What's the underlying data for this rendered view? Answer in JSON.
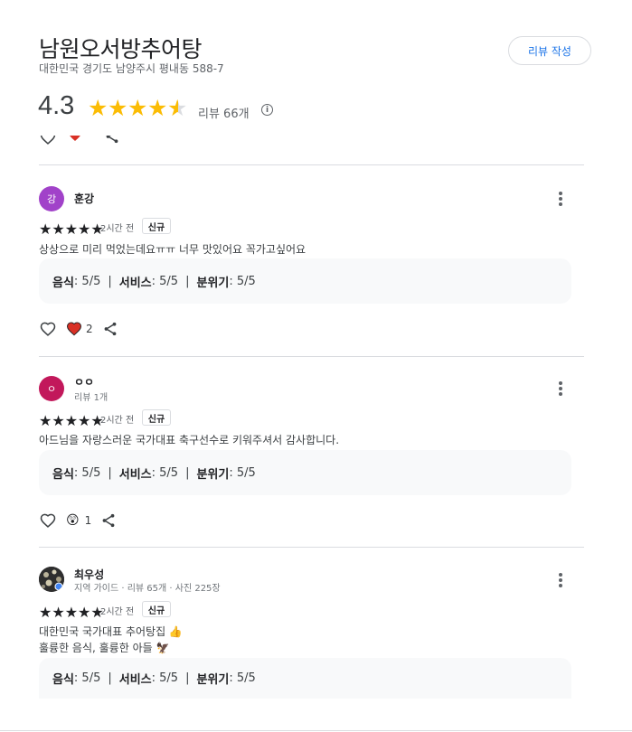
{
  "place": {
    "name": "남원오서방추어탕",
    "address": "대한민국 경기도 남양주시 평내동 588-7",
    "write_review_label": "리뷰 작성",
    "rating": "4.3",
    "rating_value": 4.3,
    "review_count": "리뷰 66개",
    "info_icon": "i"
  },
  "reviews": [
    {
      "avatar_letter": "강",
      "avatar_color": "#a142c9",
      "author": "훈강",
      "meta": "",
      "stars": "★★★★★",
      "rating_value": 5,
      "time": "2시간 전",
      "badge": "신규",
      "text_lines": [
        "상상으로 미리 먹었는데요ㅠㅠ 너무 맛있어요 꼭가고싶어요"
      ],
      "attrs": [
        {
          "label": "음식",
          "value": ": 5/5"
        },
        {
          "label": "서비스",
          "value": ": 5/5"
        },
        {
          "label": "분위기",
          "value": ": 5/5"
        }
      ],
      "separator": "|",
      "reaction_emoji": "heart",
      "reaction_count": "2"
    },
    {
      "avatar_letter": "ㅇ",
      "avatar_color": "#c2185b",
      "author": "ㅇㅇ",
      "meta": "리뷰 1개",
      "stars": "★★★★★",
      "rating_value": 5,
      "time": "2시간 전",
      "badge": "신규",
      "text_lines": [
        "아드님을 자랑스러운 국가대표 축구선수로 키워주셔서 감사합니다."
      ],
      "attrs": [
        {
          "label": "음식",
          "value": ": 5/5"
        },
        {
          "label": "서비스",
          "value": ": 5/5"
        },
        {
          "label": "분위기",
          "value": ": 5/5"
        }
      ],
      "separator": "|",
      "reaction_emoji": "😲",
      "reaction_count": "1"
    },
    {
      "avatar_letter": "",
      "avatar_color": "#3c3c3c",
      "author": "최우성",
      "meta": "지역 가이드 · 리뷰 65개 · 사진 225장",
      "stars": "★★★★★",
      "rating_value": 5,
      "time": "2시간 전",
      "badge": "신규",
      "text_lines": [
        "대한민국 국가대표 추어탕집 👍",
        "훌륭한 음식, 훌륭한 아들 🦅"
      ],
      "attrs": [
        {
          "label": "음식",
          "value": ": 5/5"
        },
        {
          "label": "서비스",
          "value": ": 5/5"
        },
        {
          "label": "분위기",
          "value": ": 5/5"
        }
      ],
      "separator": "|"
    }
  ],
  "colors": {
    "star": "#fbbc04",
    "accent": "#1a73e8",
    "heart": "#d93025"
  }
}
